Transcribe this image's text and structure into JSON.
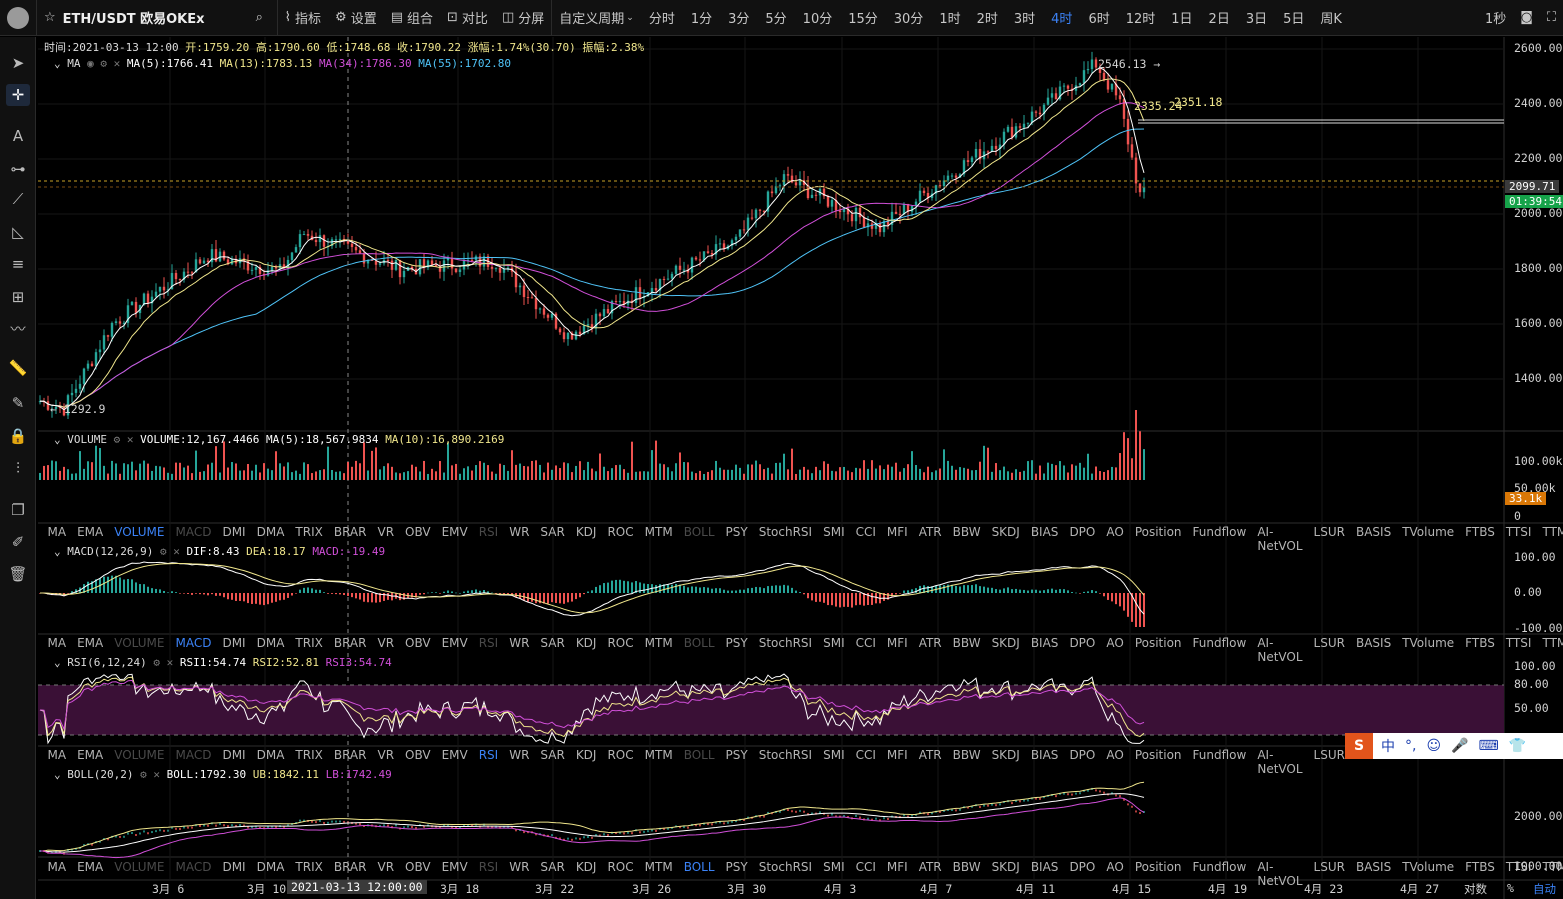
{
  "topbar": {
    "symbol": "ETH/USDT 欧易OKEx",
    "indicators": "指标",
    "settings": "设置",
    "combo": "组合",
    "compare": "对比",
    "split": "分屏",
    "custom": "自定义周期",
    "periods": [
      "分时",
      "1分",
      "3分",
      "5分",
      "10分",
      "15分",
      "30分",
      "1时",
      "2时",
      "3时",
      "4时",
      "6时",
      "12时",
      "1日",
      "2日",
      "3日",
      "5日",
      "周K"
    ],
    "active_period": "4时",
    "interval": "1秒"
  },
  "ohlc": {
    "time": "时间:2021-03-13 12:00",
    "open": "开:1759.20",
    "high": "高:1790.60",
    "low": "低:1748.68",
    "close": "收:1790.22",
    "change": "涨幅:1.74%(30.70)",
    "amplitude": "振幅:2.38%"
  },
  "ma_legend": {
    "name": "MA",
    "ma5": "MA(5):1766.41",
    "ma13": "MA(13):1783.13",
    "ma34": "MA(34):1786.30",
    "ma55": "MA(55):1702.80"
  },
  "vol_legend": {
    "name": "VOLUME",
    "vol": "VOLUME:12,167.4466",
    "ma5": "MA(5):18,567.9834",
    "ma10": "MA(10):16,890.2169"
  },
  "macd_legend": {
    "name": "MACD(12,26,9)",
    "dif": "DIF:8.43",
    "dea": "DEA:18.17",
    "macd": "MACD:-19.49"
  },
  "rsi_legend": {
    "name": "RSI(6,12,24)",
    "rsi1": "RSI1:54.74",
    "rsi2": "RSI2:52.81",
    "rsi3": "RSI3:54.74"
  },
  "boll_legend": {
    "name": "BOLL(20,2)",
    "boll": "BOLL:1792.30",
    "ub": "UB:1842.11",
    "lb": "LB:1742.49"
  },
  "indicator_tabs": [
    "MA",
    "EMA",
    "VOLUME",
    "MACD",
    "DMI",
    "DMA",
    "TRIX",
    "BRAR",
    "VR",
    "OBV",
    "EMV",
    "RSI",
    "WR",
    "SAR",
    "KDJ",
    "ROC",
    "MTM",
    "BOLL",
    "PSY",
    "StochRSI",
    "SMI",
    "CCI",
    "MFI",
    "ATR",
    "BBW",
    "SKDJ",
    "BIAS",
    "DPO",
    "AO",
    "Position",
    "Fundflow",
    "AI-NetVOL",
    "LSUR",
    "BASIS",
    "TVolume",
    "FTBS",
    "TTSI",
    "TTMU"
  ],
  "price_axis": [
    "2600.00",
    "2400.00",
    "2200.00",
    "2000.00",
    "1800.00",
    "1600.00",
    "1400.00"
  ],
  "vol_axis": [
    "100.00k",
    "50.00k",
    "0"
  ],
  "macd_axis": [
    "100.00",
    "0.00",
    "-100.00"
  ],
  "rsi_axis": [
    "100.00",
    "80.00",
    "50.00"
  ],
  "boll_axis": [
    "2000.00",
    "1000.00"
  ],
  "date_axis": [
    "3月 6",
    "3月 10",
    "3月 18",
    "3月 22",
    "3月 26",
    "3月 30",
    "4月 3",
    "4月 7",
    "4月 11",
    "4月 15",
    "4月 19",
    "4月 23",
    "4月 27"
  ],
  "crosshair_date": "2021-03-13 12:00:00",
  "bottom_right": {
    "log": "对数",
    "pct": "%",
    "auto": "自动"
  },
  "annotations": {
    "high": "2546.13",
    "low": "1292.9",
    "ma_a": "2335.24",
    "ma_b": "2351.18",
    "last_price": "2099.71",
    "countdown": "01:39:54",
    "vol_last": "33.1k"
  },
  "ime": {
    "label": "中"
  },
  "colors": {
    "up": "#26a69a",
    "down": "#ef5350",
    "ma5": "#ffffff",
    "ma13": "#f0e68c",
    "ma34": "#d04fd8",
    "ma55": "#4fc3f7",
    "accent": "#3b82f6",
    "rsi_band": "#3a1036"
  },
  "chart_data": {
    "type": "candlestick",
    "title": "ETH/USDT 4h",
    "start": "2021-03-03",
    "ylim": [
      1250,
      2650
    ],
    "key_points": [
      {
        "x": "2021-03-03",
        "y": 1320
      },
      {
        "x": "2021-03-04",
        "y": 1292.9
      },
      {
        "x": "2021-03-06",
        "y": 1600
      },
      {
        "x": "2021-03-10",
        "y": 1850
      },
      {
        "x": "2021-03-13",
        "y": 1790
      },
      {
        "x": "2021-03-14",
        "y": 1930
      },
      {
        "x": "2021-03-18",
        "y": 1800
      },
      {
        "x": "2021-03-22",
        "y": 1830
      },
      {
        "x": "2021-03-25",
        "y": 1560
      },
      {
        "x": "2021-03-28",
        "y": 1720
      },
      {
        "x": "2021-04-01",
        "y": 1900
      },
      {
        "x": "2021-04-03",
        "y": 2130
      },
      {
        "x": "2021-04-07",
        "y": 1950
      },
      {
        "x": "2021-04-10",
        "y": 2150
      },
      {
        "x": "2021-04-14",
        "y": 2400
      },
      {
        "x": "2021-04-16",
        "y": 2546.13
      },
      {
        "x": "2021-04-17",
        "y": 2400
      },
      {
        "x": "2021-04-18",
        "y": 2000
      },
      {
        "x": "2021-04-18",
        "y": 2099.71
      }
    ]
  }
}
